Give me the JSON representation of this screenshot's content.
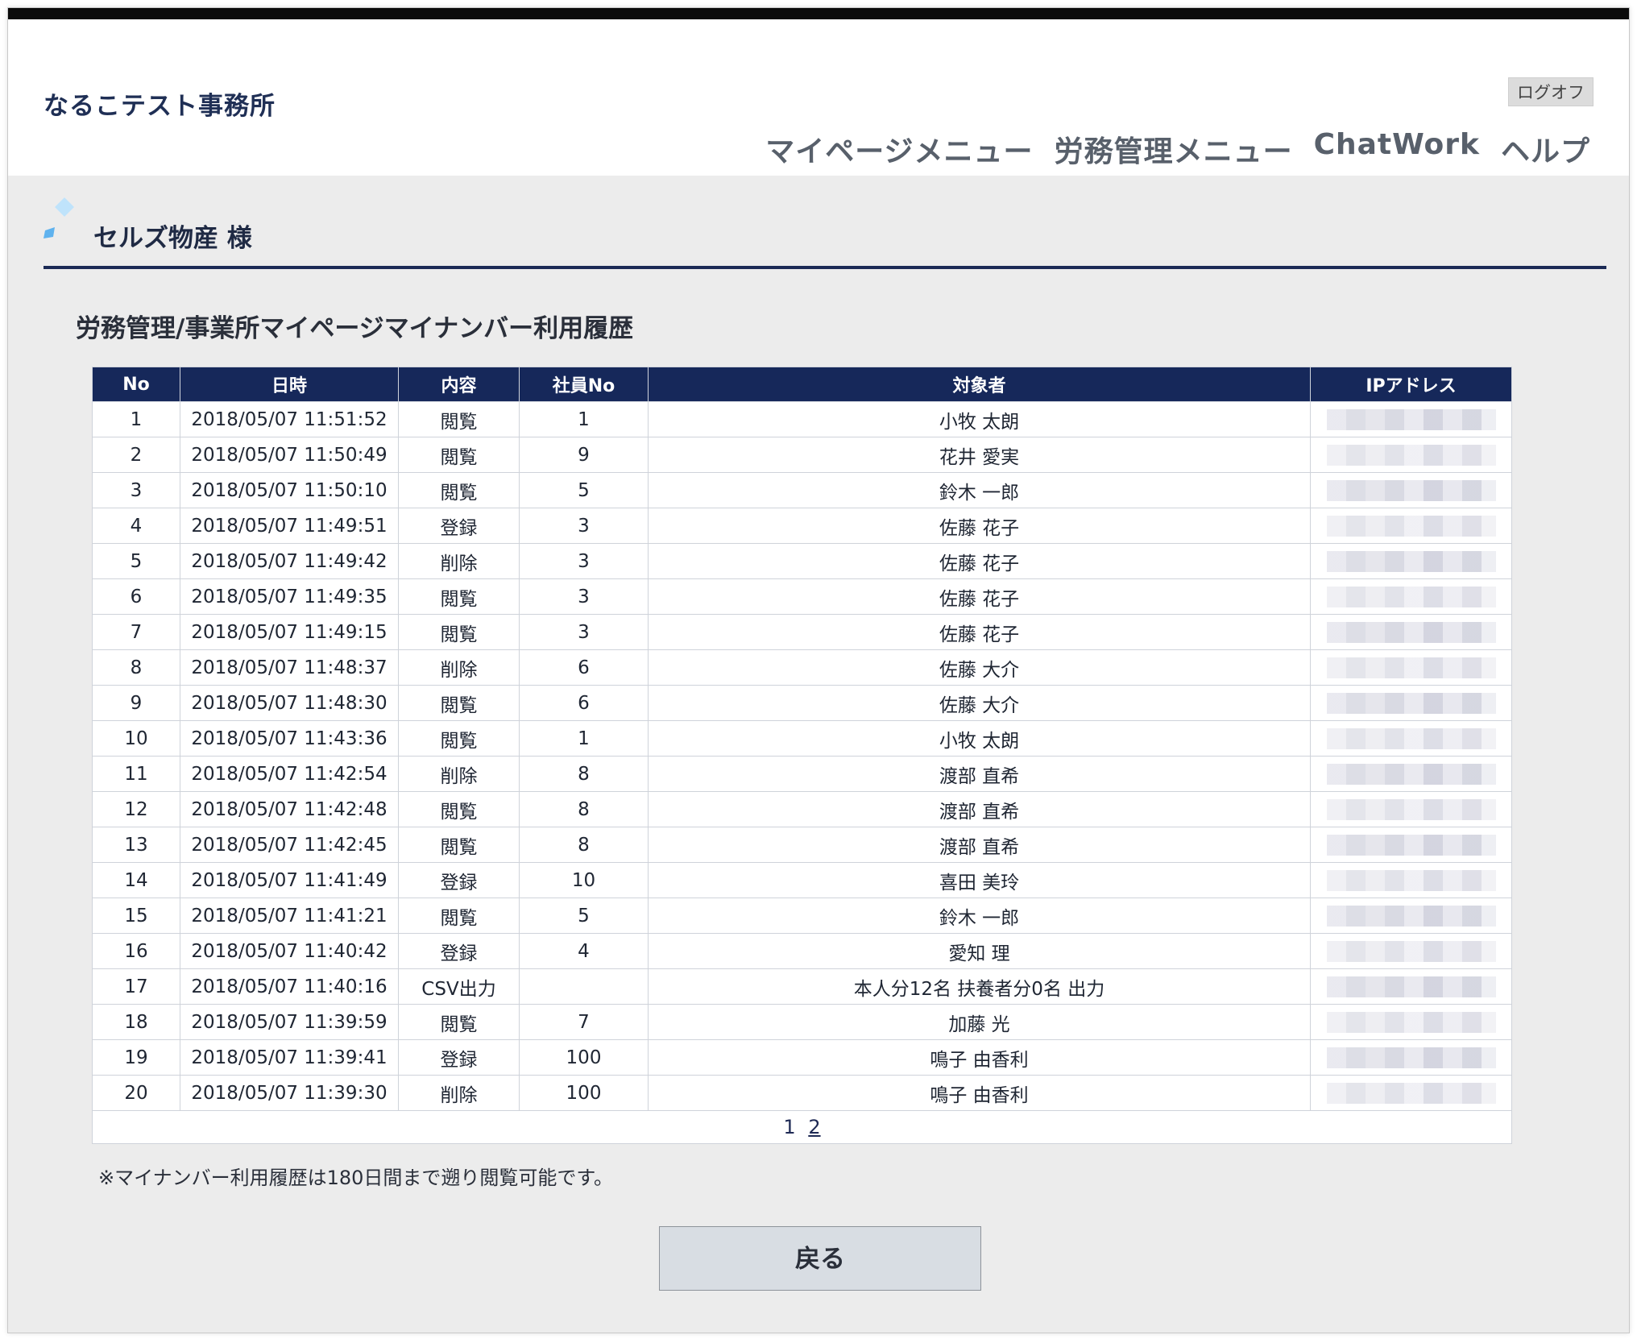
{
  "header": {
    "office_name": "なるこテスト事務所",
    "logoff_label": "ログオフ",
    "nav": [
      {
        "label": "マイページメニュー"
      },
      {
        "label": "労務管理メニュー"
      },
      {
        "label": "ChatWork"
      },
      {
        "label": "ヘルプ"
      }
    ]
  },
  "company": {
    "name": "セルズ物産 様"
  },
  "page_title": "労務管理/事業所マイページマイナンバー利用履歴",
  "table": {
    "columns": [
      "No",
      "日時",
      "内容",
      "社員No",
      "対象者",
      "IPアドレス"
    ],
    "rows": [
      {
        "no": "1",
        "datetime": "2018/05/07 11:51:52",
        "action": "閲覧",
        "emp_no": "1",
        "target": "小牧 太朗"
      },
      {
        "no": "2",
        "datetime": "2018/05/07 11:50:49",
        "action": "閲覧",
        "emp_no": "9",
        "target": "花井 愛実"
      },
      {
        "no": "3",
        "datetime": "2018/05/07 11:50:10",
        "action": "閲覧",
        "emp_no": "5",
        "target": "鈴木 一郎"
      },
      {
        "no": "4",
        "datetime": "2018/05/07 11:49:51",
        "action": "登録",
        "emp_no": "3",
        "target": "佐藤 花子"
      },
      {
        "no": "5",
        "datetime": "2018/05/07 11:49:42",
        "action": "削除",
        "emp_no": "3",
        "target": "佐藤 花子"
      },
      {
        "no": "6",
        "datetime": "2018/05/07 11:49:35",
        "action": "閲覧",
        "emp_no": "3",
        "target": "佐藤 花子"
      },
      {
        "no": "7",
        "datetime": "2018/05/07 11:49:15",
        "action": "閲覧",
        "emp_no": "3",
        "target": "佐藤 花子"
      },
      {
        "no": "8",
        "datetime": "2018/05/07 11:48:37",
        "action": "削除",
        "emp_no": "6",
        "target": "佐藤 大介"
      },
      {
        "no": "9",
        "datetime": "2018/05/07 11:48:30",
        "action": "閲覧",
        "emp_no": "6",
        "target": "佐藤 大介"
      },
      {
        "no": "10",
        "datetime": "2018/05/07 11:43:36",
        "action": "閲覧",
        "emp_no": "1",
        "target": "小牧 太朗"
      },
      {
        "no": "11",
        "datetime": "2018/05/07 11:42:54",
        "action": "削除",
        "emp_no": "8",
        "target": "渡部 直希"
      },
      {
        "no": "12",
        "datetime": "2018/05/07 11:42:48",
        "action": "閲覧",
        "emp_no": "8",
        "target": "渡部 直希"
      },
      {
        "no": "13",
        "datetime": "2018/05/07 11:42:45",
        "action": "閲覧",
        "emp_no": "8",
        "target": "渡部 直希"
      },
      {
        "no": "14",
        "datetime": "2018/05/07 11:41:49",
        "action": "登録",
        "emp_no": "10",
        "target": "喜田 美玲"
      },
      {
        "no": "15",
        "datetime": "2018/05/07 11:41:21",
        "action": "閲覧",
        "emp_no": "5",
        "target": "鈴木 一郎"
      },
      {
        "no": "16",
        "datetime": "2018/05/07 11:40:42",
        "action": "登録",
        "emp_no": "4",
        "target": "愛知 理"
      },
      {
        "no": "17",
        "datetime": "2018/05/07 11:40:16",
        "action": "CSV出力",
        "emp_no": "",
        "target": "本人分12名 扶養者分0名 出力"
      },
      {
        "no": "18",
        "datetime": "2018/05/07 11:39:59",
        "action": "閲覧",
        "emp_no": "7",
        "target": "加藤 光"
      },
      {
        "no": "19",
        "datetime": "2018/05/07 11:39:41",
        "action": "登録",
        "emp_no": "100",
        "target": "鳴子 由香利"
      },
      {
        "no": "20",
        "datetime": "2018/05/07 11:39:30",
        "action": "削除",
        "emp_no": "100",
        "target": "鳴子 由香利"
      }
    ],
    "pagination": {
      "current": "1",
      "pages": [
        "1",
        "2"
      ]
    }
  },
  "note": "※マイナンバー利用履歴は180日間まで遡り閲覧可能です。",
  "back_button_label": "戻る",
  "colors": {
    "header_bg": "#16285a",
    "accent_rule": "#1b2a55",
    "diamond_light": "#bfe3fb",
    "diamond_dark": "#5fb2ee"
  }
}
